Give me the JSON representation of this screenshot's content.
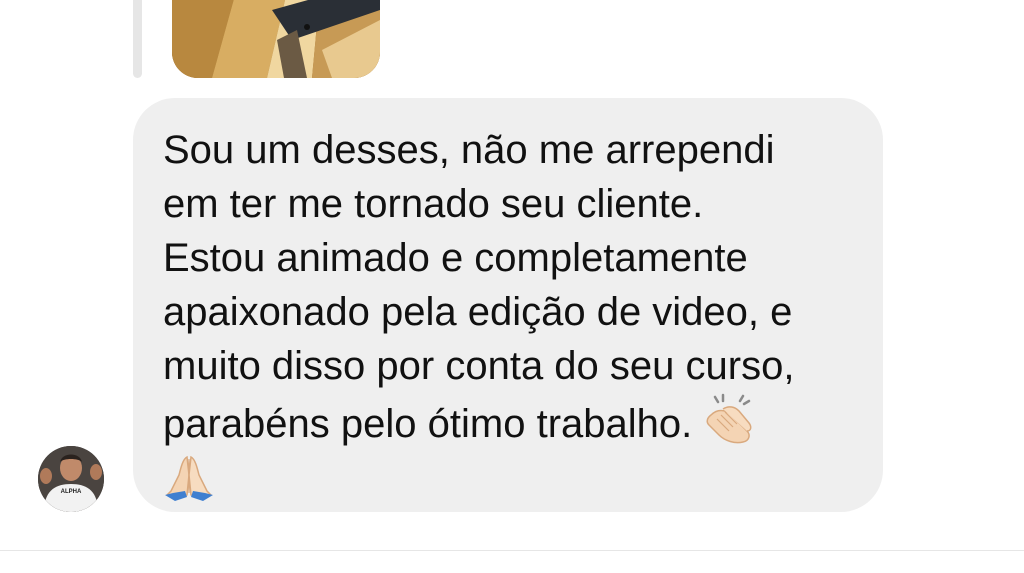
{
  "conversation": {
    "replied_media": {
      "icon": "photo-thumbnail"
    },
    "message": {
      "lines": [
        "Sou um desses, não me arrependi",
        "em ter me tornado seu cliente.",
        "Estou animado e completamente",
        "apaixonado pela edição de video, e",
        "muito disso por conta do seu curso,",
        "parabéns pelo ótimo trabalho."
      ],
      "emojis": [
        "clapping-hands-emoji",
        "folded-hands-emoji"
      ]
    },
    "sender": {
      "avatar_shirt_text": "ALPHA"
    }
  },
  "colors": {
    "background": "#ffffff",
    "bubble": "#efefef",
    "text": "#111111",
    "reply_line": "#e6e6e6"
  }
}
